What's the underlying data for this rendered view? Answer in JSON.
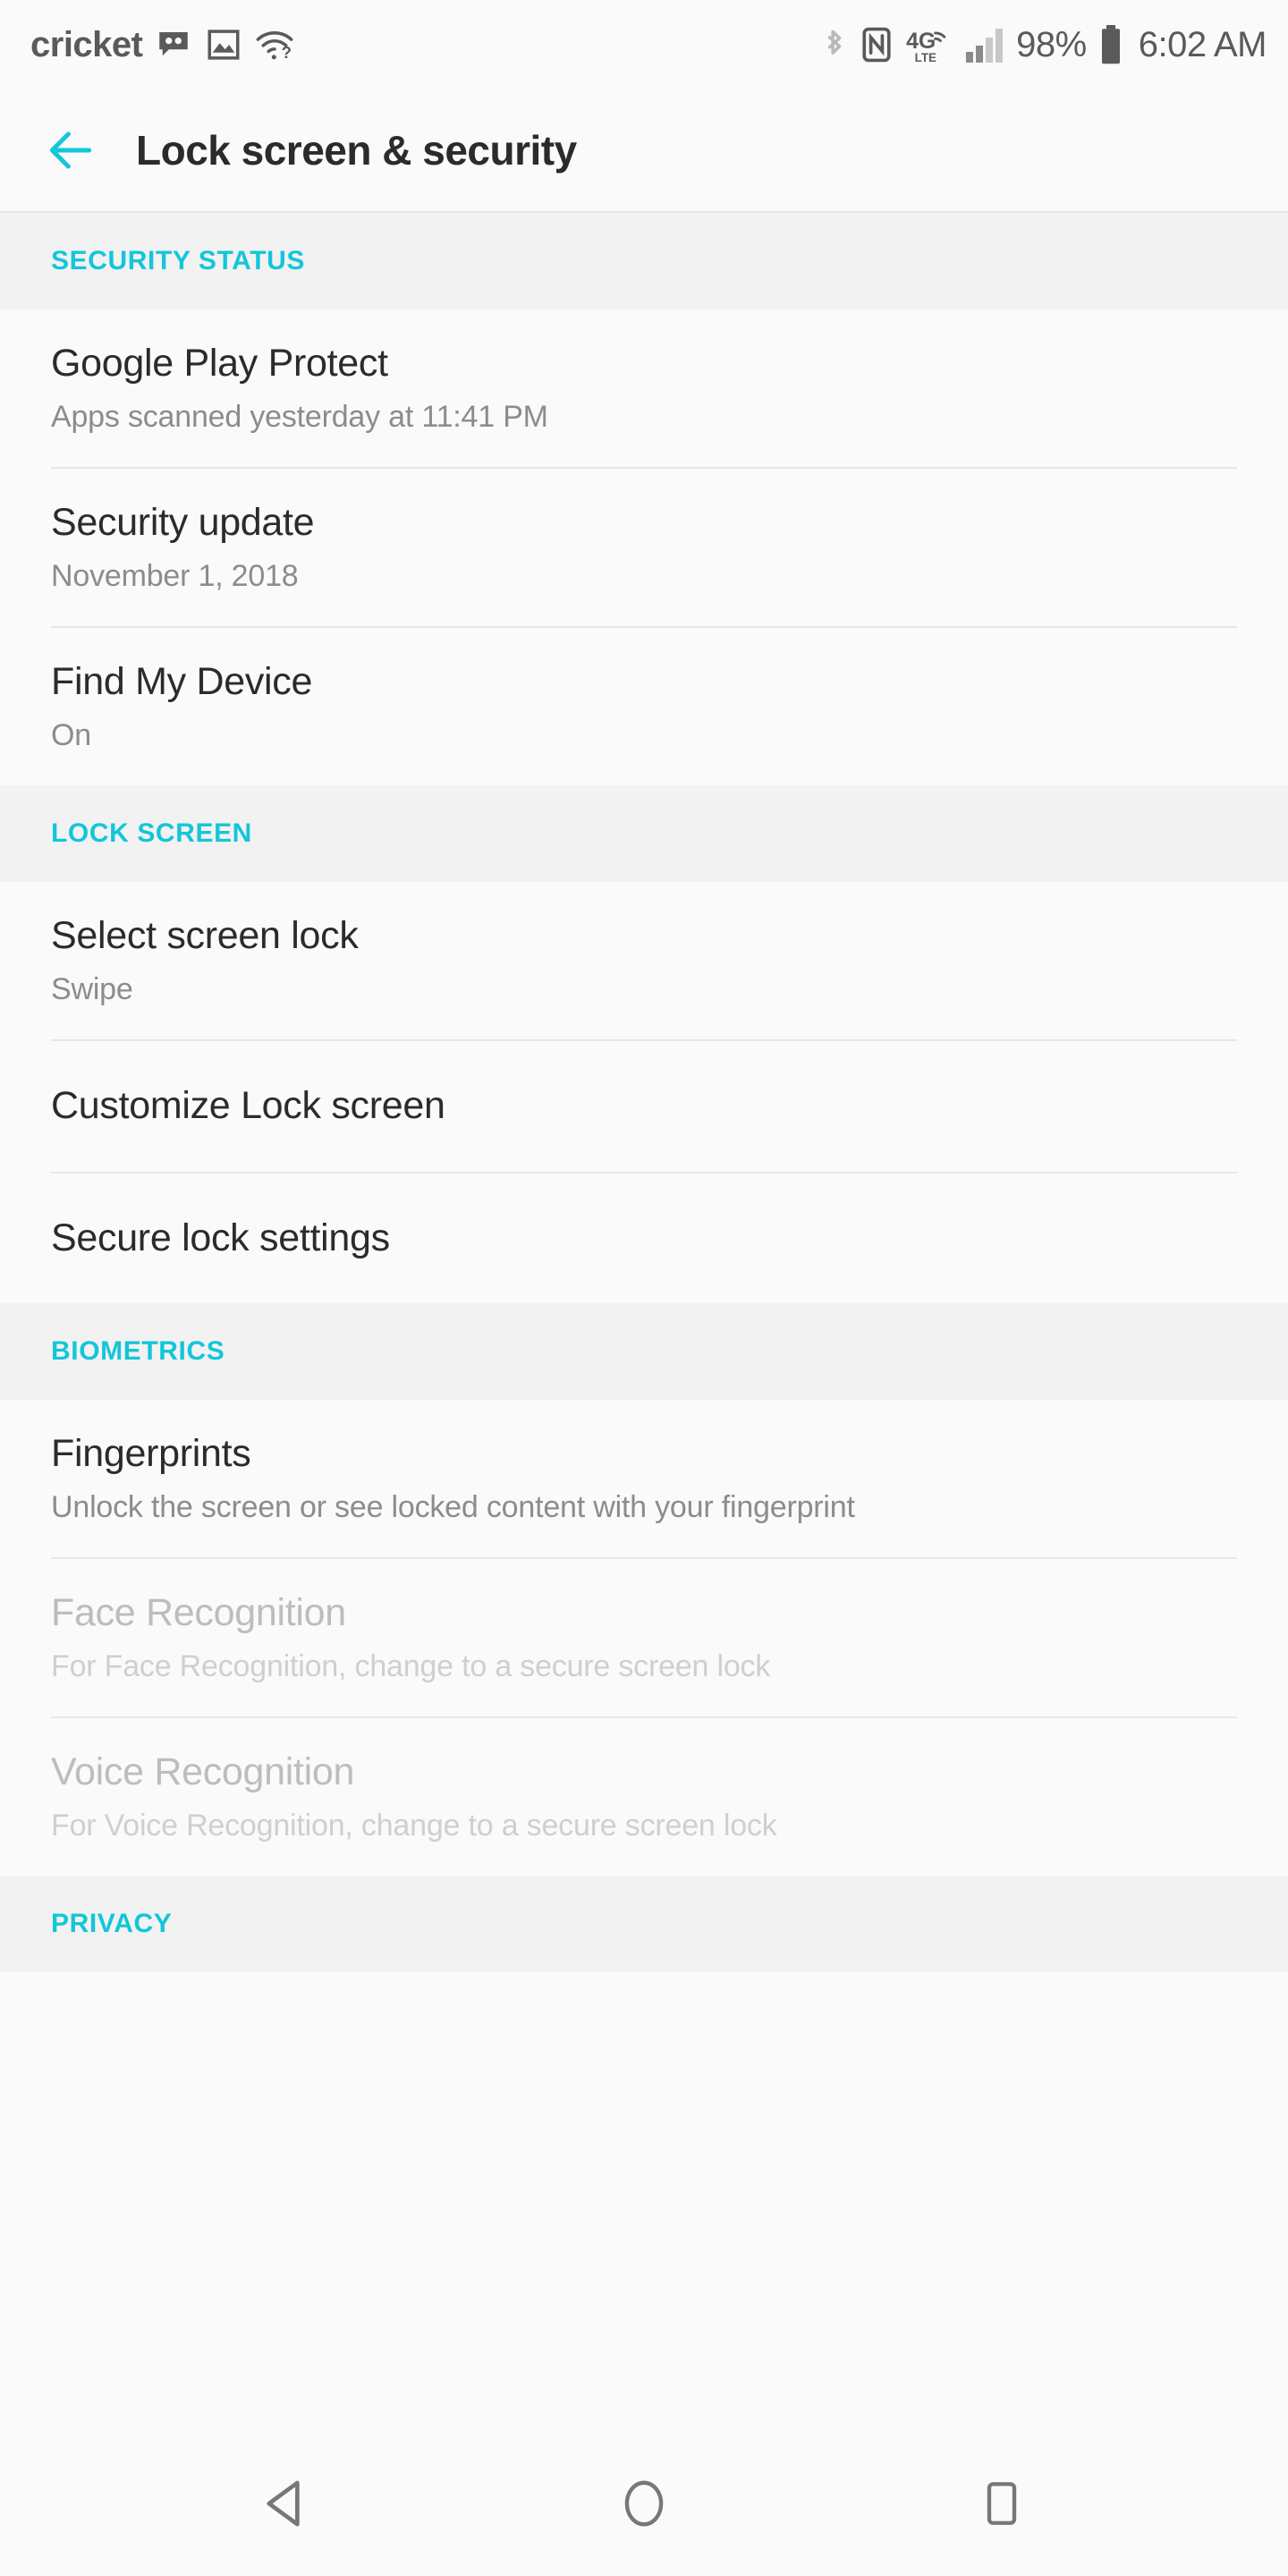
{
  "status_bar": {
    "carrier": "cricket",
    "battery_percent": "98%",
    "clock": "6:02 AM",
    "left_icons": [
      "voicemail-icon",
      "screenshot-icon",
      "wifi-question-icon"
    ],
    "right_icons": [
      "bluetooth-icon",
      "nfc-icon",
      "4g-lte-icon",
      "signal-bars-icon",
      "battery-icon"
    ]
  },
  "header": {
    "title": "Lock screen & security",
    "back_icon": "back-arrow-icon",
    "accent_color": "#13c6da"
  },
  "sections": [
    {
      "label": "SECURITY STATUS",
      "rows": [
        {
          "title": "Google Play Protect",
          "subtitle": "Apps scanned yesterday at 11:41 PM",
          "disabled": false
        },
        {
          "title": "Security update",
          "subtitle": "November 1, 2018",
          "disabled": false
        },
        {
          "title": "Find My Device",
          "subtitle": "On",
          "disabled": false
        }
      ]
    },
    {
      "label": "LOCK SCREEN",
      "rows": [
        {
          "title": "Select screen lock",
          "subtitle": "Swipe",
          "disabled": false
        },
        {
          "title": "Customize Lock screen",
          "subtitle": "",
          "disabled": false
        },
        {
          "title": "Secure lock settings",
          "subtitle": "",
          "disabled": false
        }
      ]
    },
    {
      "label": "BIOMETRICS",
      "rows": [
        {
          "title": "Fingerprints",
          "subtitle": "Unlock the screen or see locked content with your fingerprint",
          "disabled": false
        },
        {
          "title": "Face Recognition",
          "subtitle": "For Face Recognition, change to a secure screen lock",
          "disabled": true
        },
        {
          "title": "Voice Recognition",
          "subtitle": "For Voice Recognition, change to a secure screen lock",
          "disabled": true
        }
      ]
    },
    {
      "label": "PRIVACY",
      "rows": []
    }
  ],
  "nav_bar": {
    "back_label": "back-nav-icon",
    "home_label": "home-nav-icon",
    "recents_label": "recents-nav-icon"
  }
}
